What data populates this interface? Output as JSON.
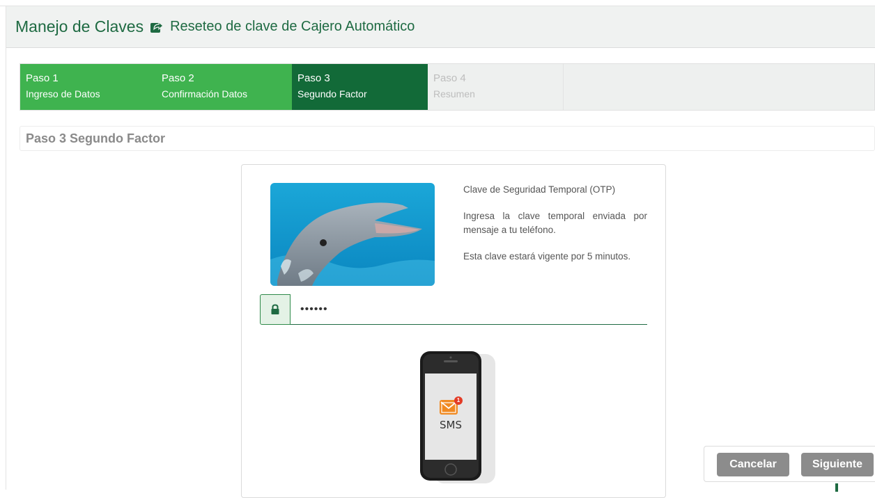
{
  "header": {
    "title": "Manejo de Claves",
    "subtitle": "Reseteo de clave de Cajero Automático",
    "icon": "share-square-icon"
  },
  "steps": [
    {
      "number": "Paso 1",
      "label": "Ingreso de Datos",
      "state": "done"
    },
    {
      "number": "Paso 2",
      "label": "Confirmación Datos",
      "state": "done"
    },
    {
      "number": "Paso 3",
      "label": "Segundo Factor",
      "state": "active"
    },
    {
      "number": "Paso 4",
      "label": "Resumen",
      "state": "todo"
    }
  ],
  "section": {
    "title": "Paso 3 Segundo Factor"
  },
  "otp_card": {
    "info_title": "Clave de Seguridad Temporal (OTP)",
    "info_text": "Ingresa la clave temporal enviada por mensaje a tu teléfono.",
    "info_validity": "Esta clave estará vigente por 5 minutos.",
    "input_value": "••••••",
    "input_icon": "lock-icon",
    "phone_label": "SMS",
    "notification_count": "1"
  },
  "actions": {
    "cancel_label": "Cancelar",
    "next_label": "Siguiente"
  },
  "colors": {
    "brand_dark": "#126a38",
    "brand_light": "#3fb34f",
    "button_gray": "#8c8c8c"
  }
}
